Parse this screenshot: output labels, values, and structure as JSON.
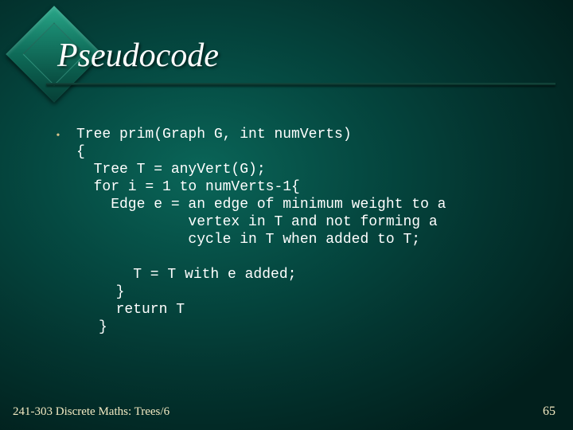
{
  "title": "Pseudocode",
  "bullet_glyph": "•",
  "code": {
    "part1": "Tree prim(Graph G, int numVerts)\n{\n  Tree T = anyVert(G);\n  for i = 1 to numVerts-1{\n    Edge e = an edge of minimum weight to a\n             vertex in T and not forming a\n             cycle in T when added to T;",
    "part2": "    T = T with e added;\n  }\n  return T\n}"
  },
  "footer": "241-303 Discrete Maths: Trees/6",
  "page_number": "65"
}
